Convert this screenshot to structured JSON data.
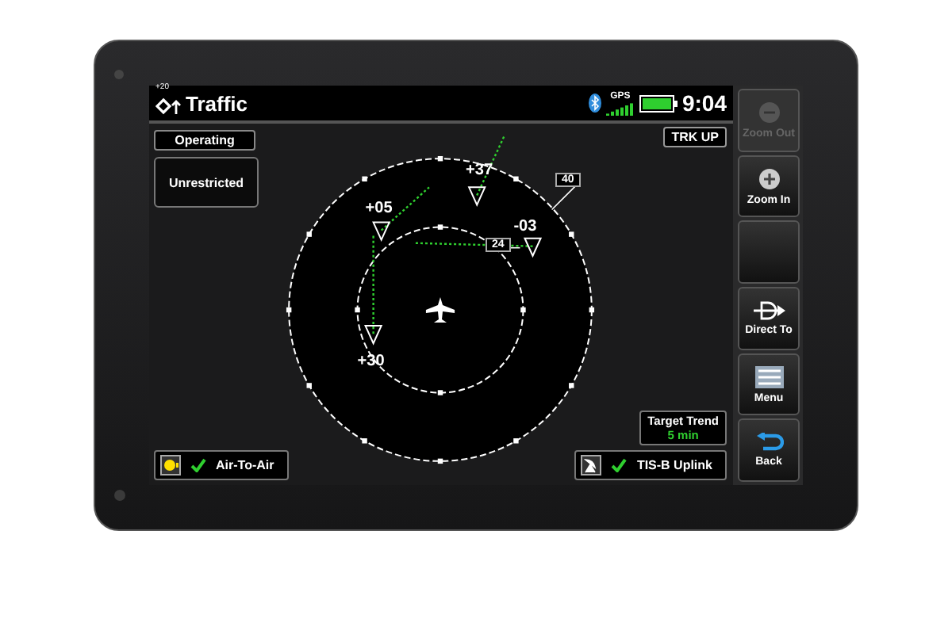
{
  "header": {
    "altitude_filter": "+20",
    "title": "Traffic",
    "gps": "GPS",
    "time": "9:04"
  },
  "mode": {
    "label": "Operating",
    "button": "Unrestricted"
  },
  "orientation": "TRK UP",
  "range_labels": [
    "40",
    "24"
  ],
  "targets": [
    {
      "label": "+37"
    },
    {
      "label": "+05"
    },
    {
      "label": "-03"
    },
    {
      "label": "+30"
    }
  ],
  "target_trend": {
    "label": "Target Trend",
    "value": "5 min"
  },
  "sources": [
    {
      "label": "Air-To-Air",
      "checked": true,
      "kind": "light"
    },
    {
      "label": "TIS-B Uplink",
      "checked": true,
      "kind": "antenna"
    }
  ],
  "side_buttons": [
    {
      "label": "Zoom Out",
      "kind": "minus",
      "disabled": true
    },
    {
      "label": "Zoom In",
      "kind": "plus",
      "disabled": false
    },
    {
      "kind": "blank",
      "disabled": false
    },
    {
      "label": "Direct To",
      "kind": "direct",
      "disabled": false
    },
    {
      "label": "Menu",
      "kind": "menu",
      "disabled": false
    },
    {
      "label": "Back",
      "kind": "back",
      "disabled": false
    }
  ]
}
